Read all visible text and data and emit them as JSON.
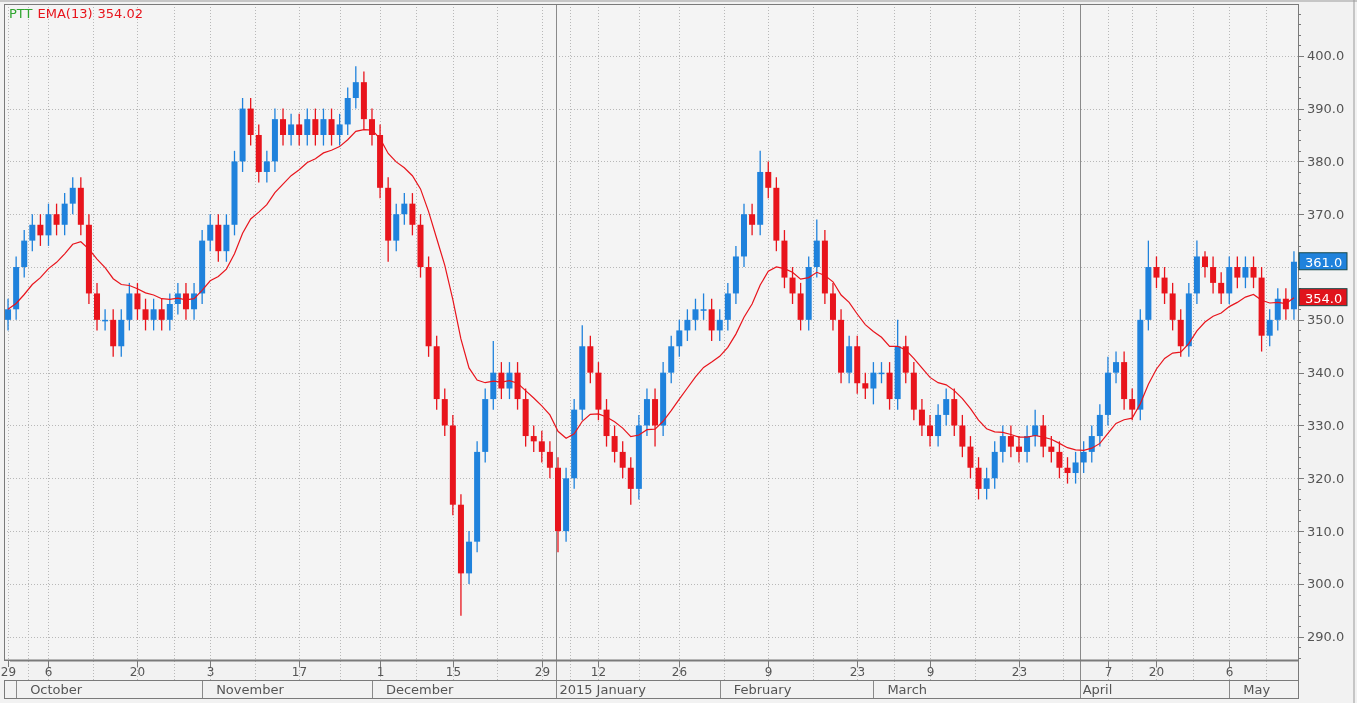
{
  "chart": {
    "legend_value": "354.02",
    "price_tags": [
      {
        "label": "361.0",
        "color": "#1f82dc"
      },
      {
        "label": "354.0",
        "color": "#e0141c"
      }
    ],
    "month_labels": [
      "October",
      "November",
      "December",
      "2015 January",
      "February",
      "March",
      "April",
      "May"
    ],
    "chart_data": {
      "type": "candlestick",
      "title": "PTT",
      "grid": true,
      "categories": [
        "29",
        null,
        null,
        null,
        null,
        "6",
        null,
        null,
        null,
        null,
        null,
        null,
        null,
        null,
        null,
        null,
        "20",
        null,
        null,
        null,
        null,
        null,
        null,
        null,
        null,
        "3",
        null,
        null,
        null,
        null,
        null,
        null,
        null,
        null,
        null,
        null,
        "17",
        null,
        null,
        null,
        null,
        null,
        null,
        null,
        null,
        null,
        "1",
        null,
        null,
        null,
        null,
        null,
        null,
        null,
        null,
        "15",
        null,
        null,
        null,
        null,
        null,
        null,
        null,
        null,
        null,
        null,
        "29",
        null,
        null,
        null,
        null,
        null,
        null,
        "12",
        null,
        null,
        null,
        null,
        null,
        null,
        null,
        null,
        null,
        "26",
        null,
        null,
        null,
        null,
        null,
        null,
        null,
        null,
        null,
        null,
        "9",
        null,
        null,
        null,
        null,
        null,
        null,
        null,
        null,
        null,
        null,
        "23",
        null,
        null,
        null,
        null,
        null,
        null,
        null,
        null,
        "9",
        null,
        null,
        null,
        null,
        null,
        null,
        null,
        null,
        null,
        null,
        "23",
        null,
        null,
        null,
        null,
        null,
        null,
        null,
        null,
        null,
        null,
        "7",
        null,
        null,
        null,
        null,
        null,
        "20",
        null,
        null,
        null,
        null,
        null,
        null,
        null,
        null,
        "6",
        null,
        null,
        null,
        null,
        null,
        null,
        null,
        null
      ],
      "ylim": [
        285.6,
        409.8
      ],
      "yticks": [
        {
          "value": 290,
          "label": "290.0"
        },
        {
          "value": 300,
          "label": "300.0"
        },
        {
          "value": 310,
          "label": "310.0"
        },
        {
          "value": 320,
          "label": "320.0"
        },
        {
          "value": 330,
          "label": "330.0"
        },
        {
          "value": 340,
          "label": "340.0"
        },
        {
          "value": 350,
          "label": "350.0"
        },
        {
          "value": 370,
          "label": "370.0"
        },
        {
          "value": 380,
          "label": "380.0"
        },
        {
          "value": 390,
          "label": "390.0"
        },
        {
          "value": 400,
          "label": "400.0"
        }
      ],
      "ohlc": [
        [
          350,
          354,
          348,
          352
        ],
        [
          352,
          362,
          350,
          360
        ],
        [
          360,
          367,
          358,
          365
        ],
        [
          365,
          370,
          363,
          368
        ],
        [
          368,
          370,
          364,
          366
        ],
        [
          366,
          372,
          364,
          370
        ],
        [
          370,
          372,
          366,
          368
        ],
        [
          368,
          374,
          366,
          372
        ],
        [
          372,
          377,
          370,
          375
        ],
        [
          375,
          377,
          366,
          368
        ],
        [
          368,
          370,
          353,
          355
        ],
        [
          355,
          357,
          348,
          350
        ],
        [
          350,
          352,
          348,
          350
        ],
        [
          350,
          352,
          343,
          345
        ],
        [
          345,
          352,
          343,
          350
        ],
        [
          350,
          357,
          348,
          355
        ],
        [
          355,
          357,
          350,
          352
        ],
        [
          352,
          354,
          348,
          350
        ],
        [
          350,
          354,
          348,
          352
        ],
        [
          352,
          354,
          348,
          350
        ],
        [
          350,
          355,
          348,
          353
        ],
        [
          353,
          357,
          351,
          355
        ],
        [
          355,
          357,
          350,
          352
        ],
        [
          352,
          357,
          350,
          355
        ],
        [
          355,
          367,
          353,
          365
        ],
        [
          365,
          370,
          363,
          368
        ],
        [
          368,
          370,
          361,
          363
        ],
        [
          363,
          370,
          361,
          368
        ],
        [
          368,
          382,
          366,
          380
        ],
        [
          380,
          392,
          378,
          390
        ],
        [
          390,
          392,
          383,
          385
        ],
        [
          385,
          387,
          376,
          378
        ],
        [
          378,
          382,
          376,
          380
        ],
        [
          380,
          390,
          378,
          388
        ],
        [
          388,
          390,
          383,
          385
        ],
        [
          385,
          389,
          383,
          387
        ],
        [
          387,
          389,
          383,
          385
        ],
        [
          385,
          390,
          383,
          388
        ],
        [
          388,
          390,
          383,
          385
        ],
        [
          385,
          390,
          383,
          388
        ],
        [
          388,
          390,
          383,
          385
        ],
        [
          385,
          389,
          383,
          387
        ],
        [
          387,
          394,
          385,
          392
        ],
        [
          392,
          398,
          390,
          395
        ],
        [
          395,
          397,
          386,
          388
        ],
        [
          388,
          390,
          383,
          385
        ],
        [
          385,
          387,
          373,
          375
        ],
        [
          375,
          377,
          361,
          365
        ],
        [
          365,
          372,
          363,
          370
        ],
        [
          370,
          374,
          368,
          372
        ],
        [
          372,
          374,
          366,
          368
        ],
        [
          368,
          370,
          358,
          360
        ],
        [
          360,
          362,
          343,
          345
        ],
        [
          345,
          347,
          333,
          335
        ],
        [
          335,
          337,
          328,
          330
        ],
        [
          330,
          332,
          313,
          315
        ],
        [
          315,
          317,
          294,
          302
        ],
        [
          302,
          310,
          300,
          308
        ],
        [
          308,
          327,
          306,
          325
        ],
        [
          325,
          337,
          323,
          335
        ],
        [
          335,
          346,
          333,
          340
        ],
        [
          340,
          342,
          335,
          337
        ],
        [
          337,
          342,
          335,
          340
        ],
        [
          340,
          342,
          333,
          335
        ],
        [
          335,
          337,
          326,
          328
        ],
        [
          328,
          330,
          325,
          327
        ],
        [
          327,
          329,
          323,
          325
        ],
        [
          325,
          327,
          320,
          322
        ],
        [
          322,
          324,
          306,
          310
        ],
        [
          310,
          322,
          308,
          320
        ],
        [
          320,
          335,
          318,
          333
        ],
        [
          333,
          349,
          331,
          345
        ],
        [
          345,
          347,
          338,
          340
        ],
        [
          340,
          342,
          331,
          333
        ],
        [
          333,
          335,
          326,
          328
        ],
        [
          328,
          330,
          323,
          325
        ],
        [
          325,
          327,
          320,
          322
        ],
        [
          322,
          324,
          315,
          318
        ],
        [
          318,
          332,
          316,
          330
        ],
        [
          330,
          337,
          328,
          335
        ],
        [
          335,
          337,
          326,
          330
        ],
        [
          330,
          342,
          328,
          340
        ],
        [
          340,
          347,
          338,
          345
        ],
        [
          345,
          350,
          343,
          348
        ],
        [
          348,
          352,
          346,
          350
        ],
        [
          350,
          354,
          348,
          352
        ],
        [
          352,
          355,
          350,
          352
        ],
        [
          352,
          354,
          346,
          348
        ],
        [
          348,
          352,
          346,
          350
        ],
        [
          350,
          357,
          348,
          355
        ],
        [
          355,
          364,
          353,
          362
        ],
        [
          362,
          372,
          360,
          370
        ],
        [
          370,
          372,
          366,
          368
        ],
        [
          368,
          382,
          366,
          378
        ],
        [
          378,
          380,
          373,
          375
        ],
        [
          375,
          377,
          363,
          365
        ],
        [
          365,
          367,
          356,
          358
        ],
        [
          358,
          360,
          353,
          355
        ],
        [
          355,
          357,
          348,
          350
        ],
        [
          350,
          362,
          348,
          360
        ],
        [
          360,
          369,
          358,
          365
        ],
        [
          365,
          367,
          353,
          355
        ],
        [
          355,
          357,
          348,
          350
        ],
        [
          350,
          352,
          338,
          340
        ],
        [
          340,
          347,
          338,
          345
        ],
        [
          345,
          347,
          336,
          338
        ],
        [
          338,
          340,
          335,
          337
        ],
        [
          337,
          342,
          334,
          340
        ],
        [
          340,
          342,
          338,
          340
        ],
        [
          340,
          342,
          333,
          335
        ],
        [
          335,
          350,
          333,
          345
        ],
        [
          345,
          347,
          338,
          340
        ],
        [
          340,
          342,
          331,
          333
        ],
        [
          333,
          335,
          328,
          330
        ],
        [
          330,
          332,
          326,
          328
        ],
        [
          328,
          334,
          326,
          332
        ],
        [
          332,
          337,
          330,
          335
        ],
        [
          335,
          337,
          328,
          330
        ],
        [
          330,
          332,
          324,
          326
        ],
        [
          326,
          328,
          320,
          322
        ],
        [
          322,
          324,
          316,
          318
        ],
        [
          318,
          322,
          316,
          320
        ],
        [
          320,
          327,
          318,
          325
        ],
        [
          325,
          330,
          323,
          328
        ],
        [
          328,
          330,
          324,
          326
        ],
        [
          326,
          328,
          323,
          325
        ],
        [
          325,
          330,
          323,
          328
        ],
        [
          328,
          333,
          326,
          330
        ],
        [
          330,
          332,
          324,
          326
        ],
        [
          326,
          328,
          323,
          325
        ],
        [
          325,
          327,
          320,
          322
        ],
        [
          322,
          324,
          319,
          321
        ],
        [
          321,
          325,
          319,
          323
        ],
        [
          323,
          327,
          321,
          325
        ],
        [
          325,
          330,
          323,
          328
        ],
        [
          328,
          334,
          326,
          332
        ],
        [
          332,
          343,
          330,
          340
        ],
        [
          340,
          344,
          338,
          342
        ],
        [
          342,
          344,
          333,
          335
        ],
        [
          335,
          337,
          331,
          333
        ],
        [
          333,
          352,
          331,
          350
        ],
        [
          350,
          365,
          348,
          360
        ],
        [
          360,
          362,
          356,
          358
        ],
        [
          358,
          360,
          353,
          355
        ],
        [
          355,
          357,
          348,
          350
        ],
        [
          350,
          352,
          343,
          345
        ],
        [
          345,
          357,
          343,
          355
        ],
        [
          355,
          365,
          353,
          362
        ],
        [
          362,
          363,
          358,
          360
        ],
        [
          360,
          362,
          355,
          357
        ],
        [
          357,
          359,
          353,
          355
        ],
        [
          355,
          362,
          353,
          360
        ],
        [
          360,
          362,
          356,
          358
        ],
        [
          358,
          362,
          356,
          360
        ],
        [
          360,
          362,
          356,
          358
        ],
        [
          358,
          360,
          344,
          347
        ],
        [
          347,
          352,
          345,
          350
        ],
        [
          350,
          356,
          348,
          354
        ],
        [
          354,
          356,
          350,
          352
        ],
        [
          352,
          363,
          350,
          361
        ]
      ],
      "series": [
        {
          "name": "EMA(13)",
          "type": "line",
          "color": "#e8141c",
          "values": [
            352,
            353.1,
            354.8,
            356.7,
            358,
            359.7,
            360.9,
            362.5,
            364.3,
            364.8,
            363.4,
            361.5,
            359.9,
            357.8,
            356.7,
            356.5,
            355.9,
            355.1,
            354.7,
            354,
            353.9,
            354.1,
            353.8,
            354,
            355.6,
            357.4,
            358.2,
            359.6,
            362.5,
            366.4,
            369.1,
            370.4,
            371.8,
            374.1,
            375.7,
            377.3,
            378.4,
            379.8,
            380.5,
            381.6,
            382.1,
            382.8,
            384.1,
            385.7,
            386,
            385.9,
            384.3,
            381.5,
            379.9,
            378.8,
            377.3,
            374.8,
            370.5,
            365.4,
            360.3,
            353.8,
            346.4,
            340.9,
            338.6,
            338.1,
            338.4,
            338.2,
            338.5,
            338,
            336.6,
            335.2,
            333.7,
            332,
            328.9,
            327.6,
            328.4,
            330.8,
            332.1,
            332.2,
            331.6,
            330.7,
            329.5,
            327.9,
            328.2,
            329.2,
            329.3,
            330.8,
            332.8,
            335,
            337.1,
            339.2,
            341,
            342,
            343.1,
            344.8,
            347.3,
            350.5,
            353,
            356.6,
            359.2,
            360,
            359.7,
            359,
            357.7,
            358,
            359,
            358.4,
            357.2,
            354.7,
            353.3,
            351.1,
            349.1,
            347.8,
            346.7,
            345,
            345,
            344.3,
            342.7,
            340.9,
            339.1,
            338.1,
            337.7,
            336.6,
            335.1,
            333.2,
            331,
            329.4,
            328.8,
            328.7,
            328.3,
            327.8,
            327.8,
            328.1,
            327.8,
            327.4,
            326.6,
            325.8,
            325.4,
            325.3,
            325.7,
            326.6,
            328.5,
            330.4,
            331.1,
            331.4,
            334.1,
            337.8,
            340.7,
            342.7,
            343.7,
            343.9,
            345.5,
            347.9,
            349.6,
            350.7,
            351.3,
            352.5,
            353.3,
            354.3,
            354.8,
            353.7,
            353.2,
            353.3,
            353.1,
            354.2
          ]
        }
      ]
    }
  }
}
